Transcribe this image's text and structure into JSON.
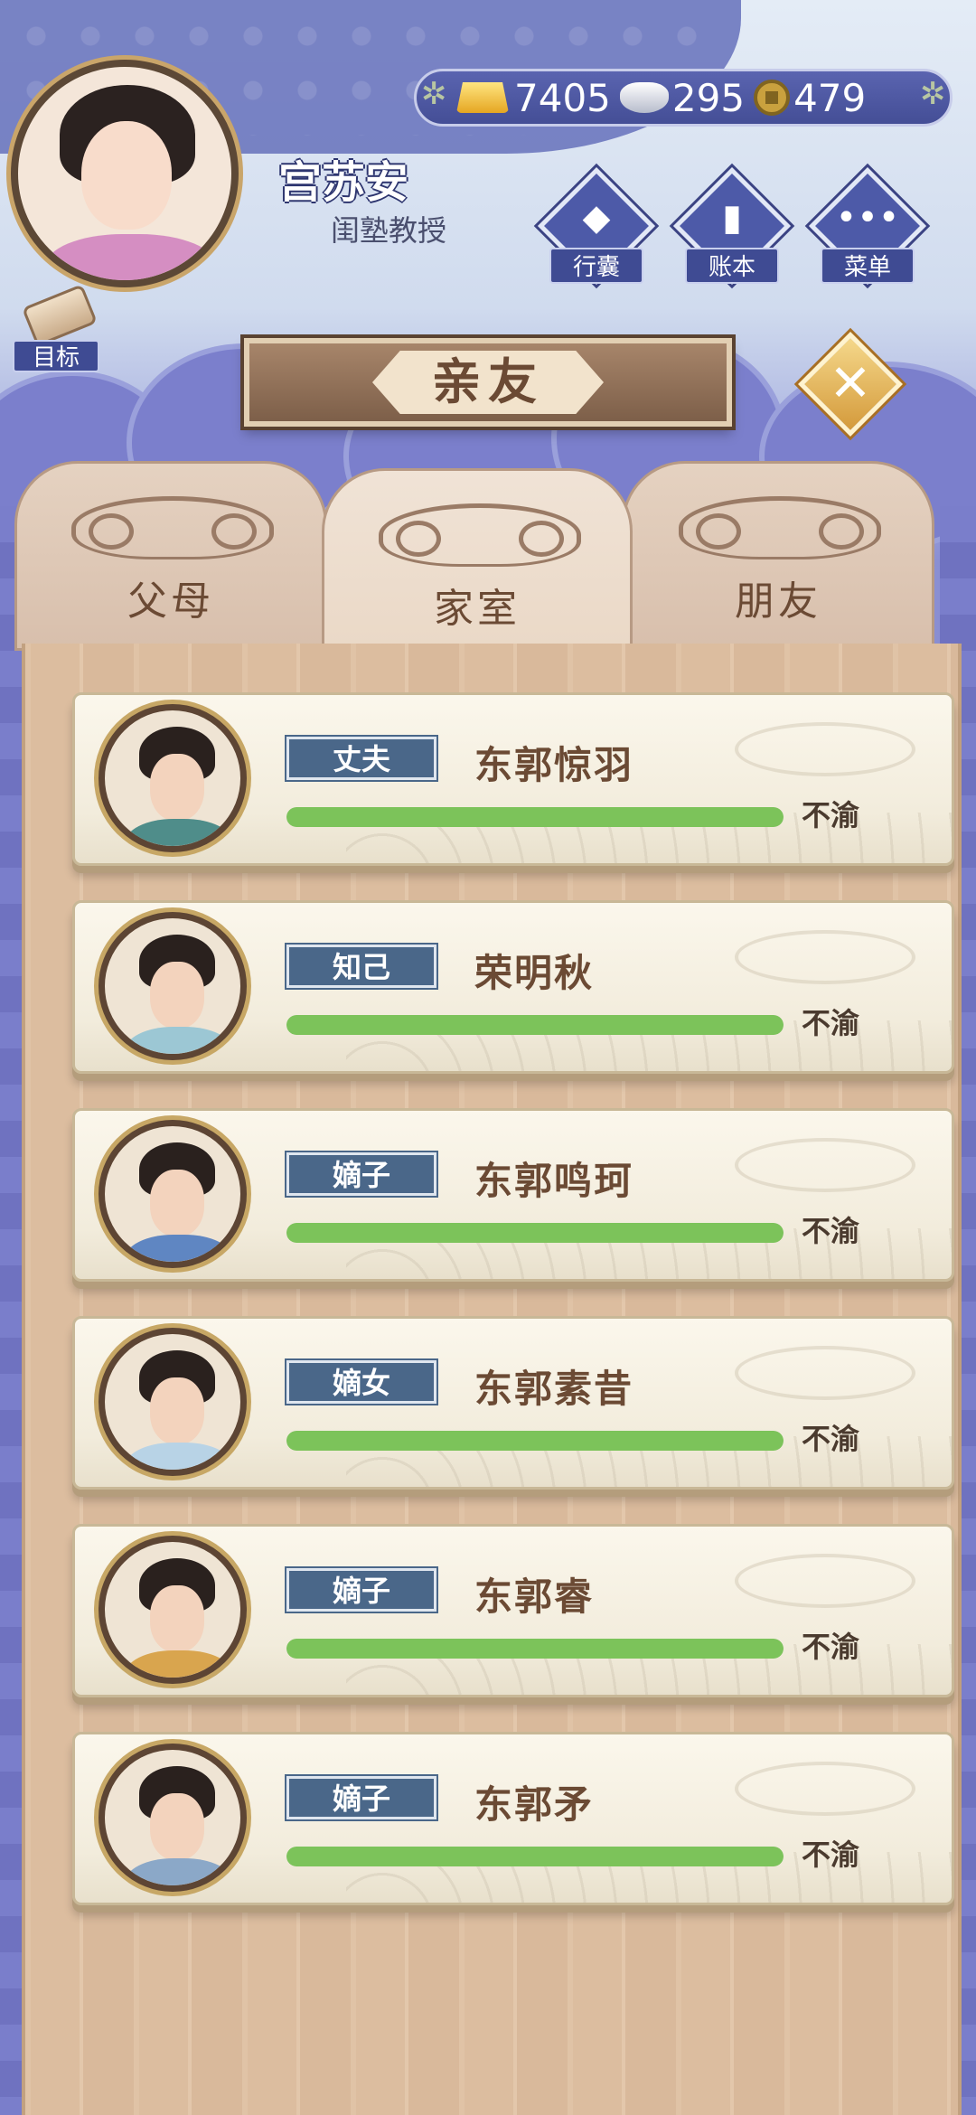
{
  "player": {
    "name": "宫苏安",
    "title": "闺塾教授"
  },
  "currency": {
    "gold": "7405",
    "silver": "295",
    "coins": "479"
  },
  "menu": {
    "bag": "行囊",
    "ledger": "账本",
    "menu": "菜单",
    "goal": "目标"
  },
  "banner": {
    "title": "亲友"
  },
  "close_glyph": "✕",
  "tabs": [
    {
      "label": "父母",
      "active": false
    },
    {
      "label": "家室",
      "active": true
    },
    {
      "label": "朋友",
      "active": false
    }
  ],
  "members": [
    {
      "role": "丈夫",
      "name": "东郭惊羽",
      "status": "不渝",
      "affection": 1.0,
      "robe": "#4f8d8a"
    },
    {
      "role": "知己",
      "name": "荣明秋",
      "status": "不渝",
      "affection": 1.0,
      "robe": "#9cc7d4"
    },
    {
      "role": "嫡子",
      "name": "东郭鸣珂",
      "status": "不渝",
      "affection": 1.0,
      "robe": "#5f86c2"
    },
    {
      "role": "嫡女",
      "name": "东郭素昔",
      "status": "不渝",
      "affection": 1.0,
      "robe": "#b8d3e6"
    },
    {
      "role": "嫡子",
      "name": "东郭睿",
      "status": "不渝",
      "affection": 1.0,
      "robe": "#d9a54e"
    },
    {
      "role": "嫡子",
      "name": "东郭矛",
      "status": "不渝",
      "affection": 1.0,
      "robe": "#8ba8c8"
    }
  ]
}
